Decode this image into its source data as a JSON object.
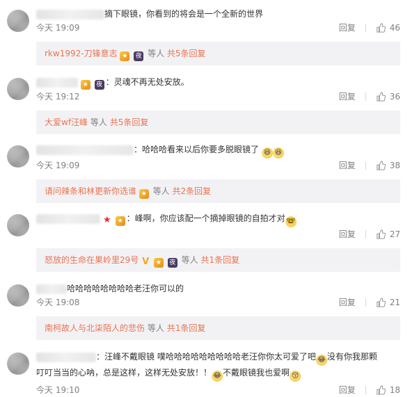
{
  "reply_label": "回复",
  "comments": [
    {
      "text": "摘下眼镜，你看到的将会是一个全新的世界",
      "time": "今天 19:09",
      "likes": "46",
      "sub": {
        "users": "rkw1992-刀锋意志",
        "suffix": "等人",
        "more": "共5条回复"
      }
    },
    {
      "text": "：灵魂不再无处安放。",
      "time": "今天 19:12",
      "likes": "36",
      "sub": {
        "users": "大爱wf汪峰",
        "suffix": "等人",
        "more": "共5条回复"
      }
    },
    {
      "text": "：哈哈哈看来以后你要多脱眼镜了",
      "time": "今天 19:09",
      "likes": "38",
      "sub": {
        "users": "请问辣条和林更新你选谁",
        "suffix": "等人",
        "more": "共2条回复"
      }
    },
    {
      "text": "：峰啊，你应该配一个摘掉眼镜的自拍才对",
      "time": "",
      "likes": "27",
      "sub": {
        "users": "怒放的生命在果岭里29号",
        "suffix": "等人",
        "more": "共1条回复"
      }
    },
    {
      "text": "哈哈哈哈哈哈哈哈老汪你可以的",
      "time": "今天 19:08",
      "likes": "21",
      "sub": {
        "users": "南柯故人与北柒陌人的悲伤",
        "suffix": "等人",
        "more": "共1条回复"
      }
    },
    {
      "text1": "：汪峰不戴眼镜 噗哈哈哈哈哈哈哈哈哈老汪你你太可爱了吧",
      "text1b": "没有你我那颗",
      "text2": "叮叮当当的心呐，总是这样，这样无处安放！！",
      "text2b": "不戴眼镜我也爱啊",
      "time": "今天 19:10",
      "likes": "18"
    }
  ]
}
